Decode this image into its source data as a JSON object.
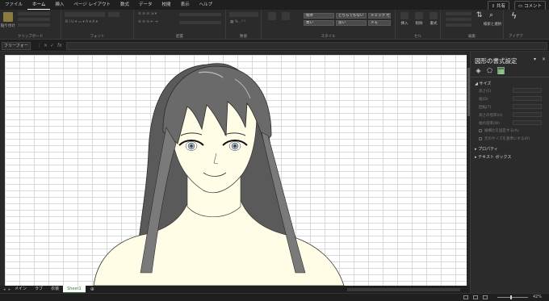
{
  "tabs": [
    "ファイル",
    "ホーム",
    "挿入",
    "ページ レイアウト",
    "数式",
    "データ",
    "校閲",
    "表示",
    "ヘルプ"
  ],
  "active_tab": "ホーム",
  "tab_right": {
    "share": "共有",
    "comments": "コメント"
  },
  "ribbon": {
    "groups": [
      "クリップボード",
      "フォント",
      "配置",
      "数値",
      "スタイル",
      "セル",
      "編集",
      "アイデア"
    ],
    "paste_label": "貼り付け",
    "styles": [
      "標準",
      "どちらでもない",
      "悪い",
      "良い",
      "チェック セル",
      "メモ"
    ],
    "cells_buttons": [
      "挿入",
      "削除",
      "書式"
    ],
    "edit_labels": [
      "検索と選択"
    ]
  },
  "formula_bar": {
    "name_box": "フリーフォー"
  },
  "sheet_tabs": [
    "メイン",
    "ラブ",
    "衣装",
    "Sheet1"
  ],
  "active_sheet": "Sheet1",
  "status": {
    "zoom": "42%"
  },
  "pane": {
    "title": "図形の書式設定",
    "section_size": "サイズ",
    "size_props": [
      "高さ(E)",
      "幅(D)",
      "回転(T)",
      "高さの倍率(H)",
      "幅の倍率(W)"
    ],
    "checkboxes": [
      "縦横比を固定する(A)",
      "元のサイズを基準にする(R)"
    ],
    "section_props": "プロパティ",
    "section_textbox": "テキスト ボックス"
  },
  "colors": {
    "accent_green": "#2e7d32",
    "skin": "#fffde6",
    "hair": "#5a5a5a"
  }
}
